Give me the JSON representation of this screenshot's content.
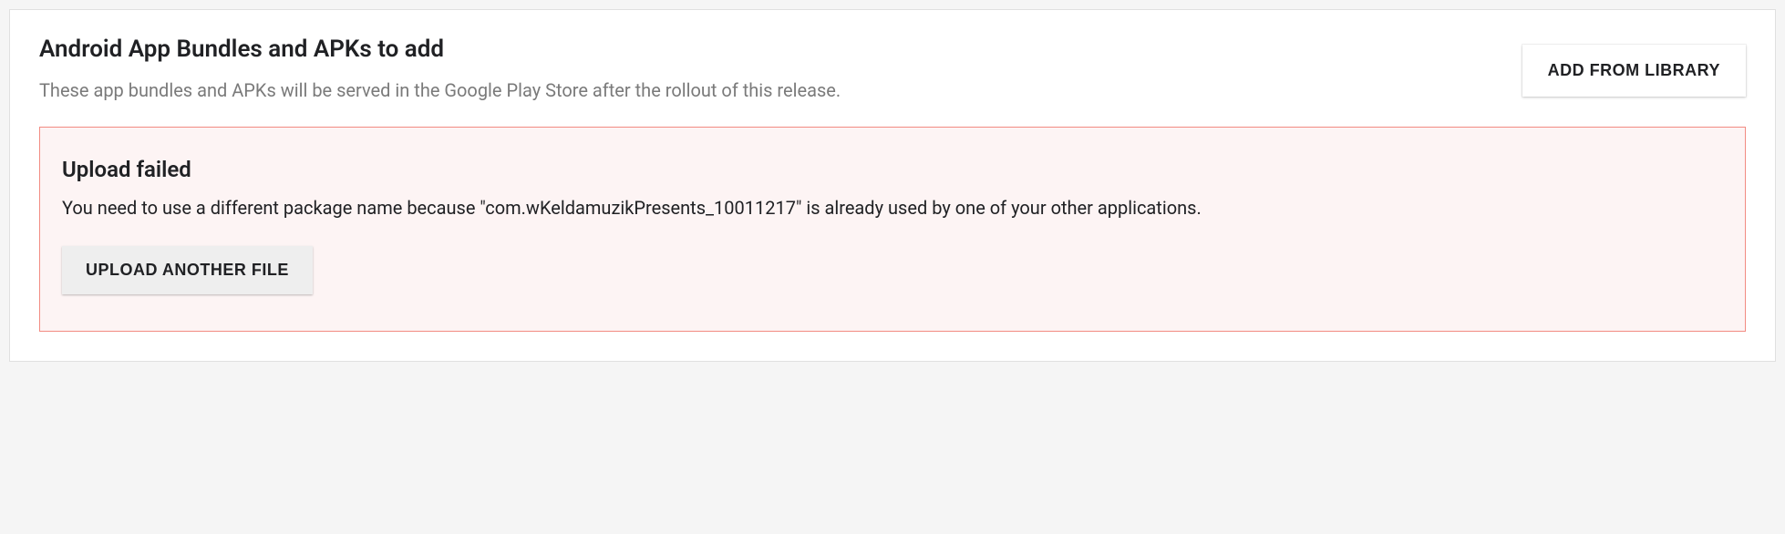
{
  "section": {
    "title": "Android App Bundles and APKs to add",
    "description": "These app bundles and APKs will be served in the Google Play Store after the rollout of this release."
  },
  "buttons": {
    "add_from_library": "ADD FROM LIBRARY",
    "upload_another": "UPLOAD ANOTHER FILE"
  },
  "error": {
    "title": "Upload failed",
    "message": "You need to use a different package name because \"com.wKeldamuzikPresents_10011217\" is already used by one of your other applications."
  }
}
